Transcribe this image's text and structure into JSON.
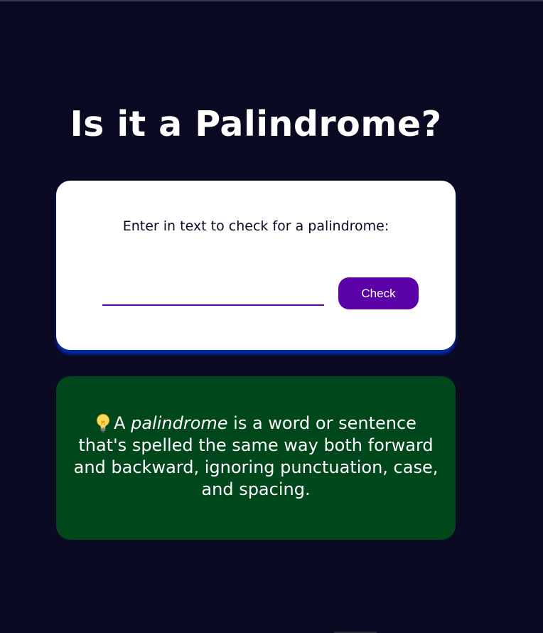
{
  "page": {
    "title": "Is it a Palindrome?"
  },
  "checker": {
    "label": "Enter in text to check for a palindrome:",
    "input_value": "",
    "input_placeholder": "",
    "button_label": "Check"
  },
  "info": {
    "icon": "lightbulb-icon",
    "before": "A ",
    "term": "palindrome",
    "after": " is a word or sentence that's spelled the same way both forward and backward, ignoring punctuation, case, and spacing."
  },
  "colors": {
    "background": "#0a0a23",
    "card": "#ffffff",
    "accent": "#5a01a7",
    "card_shadow": "#002ead",
    "info_background": "#00471b"
  }
}
